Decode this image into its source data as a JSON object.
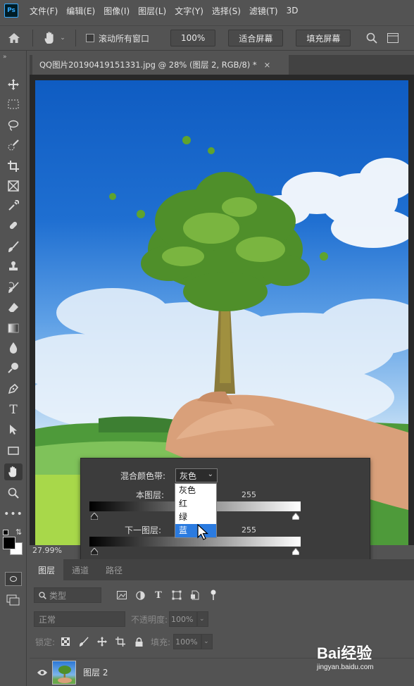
{
  "app": {
    "logo": "Ps"
  },
  "menu": [
    "文件(F)",
    "编辑(E)",
    "图像(I)",
    "图层(L)",
    "文字(Y)",
    "选择(S)",
    "滤镜(T)",
    "3D"
  ],
  "options": {
    "scroll_all_label": "滚动所有窗口",
    "zoom_value": "100%",
    "fit_screen": "适合屏幕",
    "fill_screen": "填充屏幕"
  },
  "document": {
    "tab_title": "QQ图片20190419151331.jpg @ 28% (图层 2, RGB/8) *",
    "close": "×",
    "zoom_readout": "27.99%"
  },
  "tools": [
    "move-icon",
    "marquee-icon",
    "lasso-icon",
    "quick-select-icon",
    "crop-icon",
    "frame-icon",
    "eyedropper-icon",
    "healing-icon",
    "brush-icon",
    "stamp-icon",
    "history-brush-icon",
    "eraser-icon",
    "gradient-icon",
    "blur-icon",
    "dodge-icon",
    "pen-icon",
    "type-icon",
    "path-select-icon",
    "rectangle-icon",
    "hand-icon",
    "zoom-icon",
    "more-icon"
  ],
  "blend_dialog": {
    "blend_if_label": "混合颜色带:",
    "blend_if_value": "灰色",
    "this_layer_label": "本图层:",
    "this_layer_max": "255",
    "underlying_label": "下一图层:",
    "underlying_max": "255",
    "options": [
      "灰色",
      "红",
      "绿",
      "蓝"
    ],
    "highlighted_option": "蓝"
  },
  "layers_panel": {
    "tabs": [
      "图层",
      "通道",
      "路径"
    ],
    "filter_placeholder": "类型",
    "blend_mode": "正常",
    "opacity_label": "不透明度:",
    "opacity_value": "100%",
    "lock_label": "锁定:",
    "fill_label": "填充:",
    "fill_value": "100%",
    "layer_name": "图层 2"
  },
  "watermark": {
    "brand": "Bai经验",
    "url": "jingyan.baidu.com"
  }
}
